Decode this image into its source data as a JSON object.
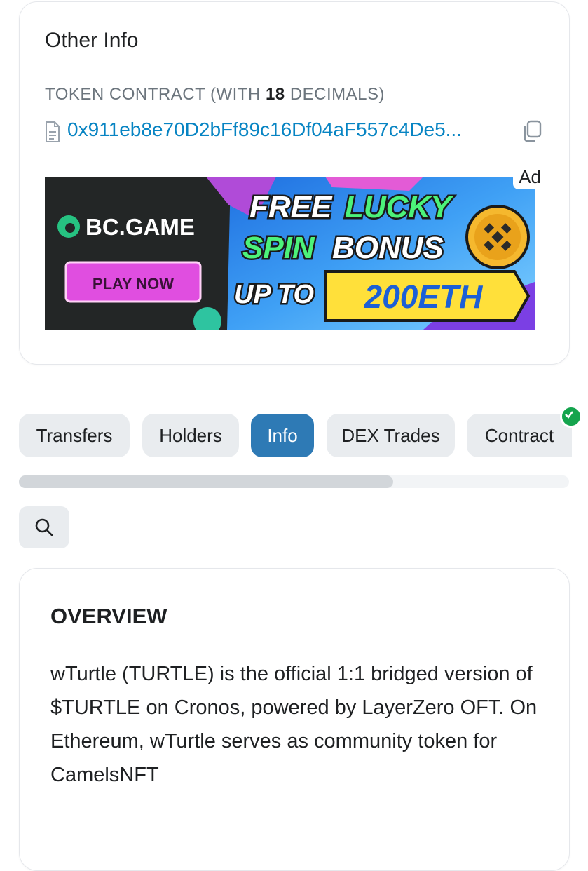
{
  "other_info": {
    "title": "Other Info",
    "contract_label_prefix": "TOKEN CONTRACT (WITH ",
    "decimals": "18",
    "contract_label_suffix": " DECIMALS)",
    "contract_address": "0x911eb8e70D2bFf89c16Df04aF557c4De5...",
    "ad": {
      "tag": "Ad",
      "brand": "BC.GAME",
      "cta": "PLAY NOW",
      "line1_a": "FREE",
      "line1_b": "LUCKY",
      "line2_a": "SPIN",
      "line2_b": "BONUS",
      "line3_a": "UP TO",
      "line3_b": "200ETH"
    }
  },
  "tabs": [
    {
      "label": "Transfers",
      "active": false
    },
    {
      "label": "Holders",
      "active": false
    },
    {
      "label": "Info",
      "active": true
    },
    {
      "label": "DEX Trades",
      "active": false
    },
    {
      "label": "Contract",
      "active": false,
      "verified": true
    }
  ],
  "tab_scroll_fraction": 0.68,
  "overview": {
    "title": "OVERVIEW",
    "text": "wTurtle (TURTLE) is the official 1:1 bridged version of $TURTLE on Cronos, powered by LayerZero OFT. On Ethereum, wTurtle serves as community token for CamelsNFT"
  },
  "colors": {
    "accent": "#2e7ab5",
    "link": "#0784c3",
    "verified": "#14a44d"
  },
  "icons": [
    "document-icon",
    "copy-icon",
    "search-icon",
    "verified-icon"
  ]
}
